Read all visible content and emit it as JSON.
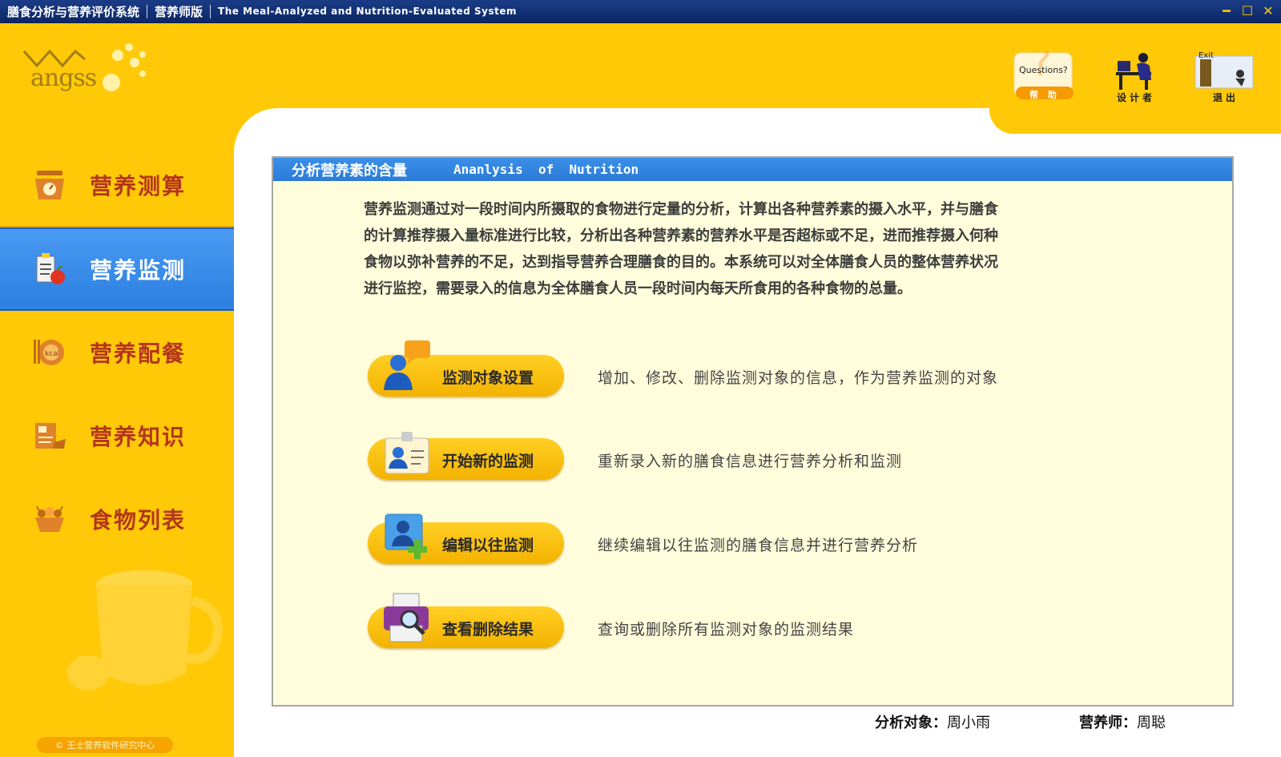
{
  "titlebar": {
    "part1": "膳食分析与营养评价系统",
    "part2": "营养师版",
    "part3": "The Meal-Analyzed and Nutrition-Evaluated System",
    "minimize": "━",
    "maximize": "☐",
    "close": "✕"
  },
  "logo": {
    "text": "angss"
  },
  "tools": {
    "help_sign": "Questions?",
    "help_label": "帮 助",
    "designer_label": "设计者",
    "exit_sign": "Exit",
    "exit_label": "退出"
  },
  "sidebar": {
    "items": [
      {
        "label": "营养测算",
        "icon": "scale-icon"
      },
      {
        "label": "营养监测",
        "icon": "monitor-clipboard-icon",
        "active": true
      },
      {
        "label": "营养配餐",
        "icon": "kcal-plate-icon"
      },
      {
        "label": "营养知识",
        "icon": "knowledge-book-icon"
      },
      {
        "label": "食物列表",
        "icon": "food-basket-icon"
      }
    ]
  },
  "copyright": "© 王士营养软件研究中心",
  "content": {
    "header_zh": "分析营养素的含量",
    "header_en": "Ananlysis  of  Nutrition",
    "intro_lines": [
      "营养监测通过对一段时间内所摄取的食物进行定量的分析，计算出各种营养素的摄入水平，并与膳食",
      "的计算推荐摄入量标准进行比较，分析出各种营养素的营养水平是否超标或不足，进而推荐摄入何种",
      "食物以弥补营养的不足，达到指导营养合理膳食的目的。本系统可以对全体膳食人员的整体营养状况",
      "进行监控，需要录入的信息为全体膳食人员一段时间内每天所食用的各种食物的总量。"
    ],
    "actions": [
      {
        "label": "监测对象设置",
        "desc": "增加、修改、删除监测对象的信息，作为营养监测的对象",
        "icon": "person-chat-icon"
      },
      {
        "label": "开始新的监测",
        "desc": "重新录入新的膳食信息进行营养分析和监测",
        "icon": "id-card-icon"
      },
      {
        "label": "编辑以往监测",
        "desc": "继续编辑以往监测的膳食信息并进行营养分析",
        "icon": "user-add-icon"
      },
      {
        "label": "查看删除结果",
        "desc": "查询或删除所有监测对象的监测结果",
        "icon": "printer-search-icon"
      }
    ]
  },
  "status": {
    "subject_label": "分析对象：",
    "subject_value": "周小雨",
    "dietitian_label": "营养师：",
    "dietitian_value": "周聪"
  }
}
